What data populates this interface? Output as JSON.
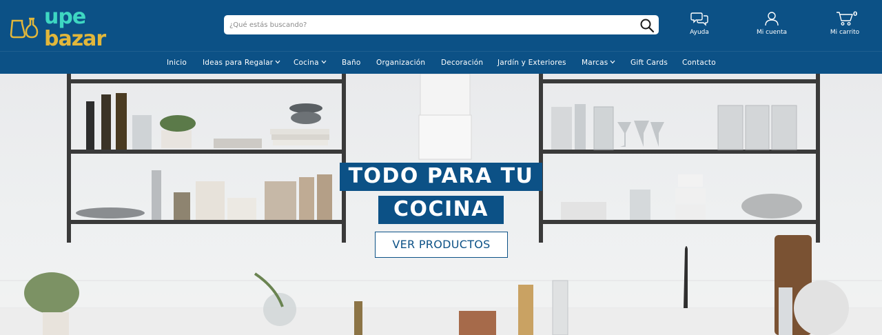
{
  "brand": {
    "logo_line1": "upe",
    "logo_line2": "bazar"
  },
  "search": {
    "placeholder": "¿Qué estás buscando?"
  },
  "header_icons": {
    "help_label": "Ayuda",
    "account_label": "Mi cuenta",
    "cart_label": "Mi carrito",
    "cart_count": "0"
  },
  "nav": {
    "items": [
      {
        "label": "Inicio",
        "has_dropdown": false
      },
      {
        "label": "Ideas para Regalar",
        "has_dropdown": true
      },
      {
        "label": "Cocina",
        "has_dropdown": true
      },
      {
        "label": "Baño",
        "has_dropdown": false
      },
      {
        "label": "Organización",
        "has_dropdown": false
      },
      {
        "label": "Decoración",
        "has_dropdown": false
      },
      {
        "label": "Jardín y Exteriores",
        "has_dropdown": false
      },
      {
        "label": "Marcas",
        "has_dropdown": true
      },
      {
        "label": "Gift Cards",
        "has_dropdown": false
      },
      {
        "label": "Contacto",
        "has_dropdown": false
      }
    ]
  },
  "hero": {
    "headline_line1": "TODO PARA TU",
    "headline_line2": "COCINA",
    "cta_label": "VER PRODUCTOS"
  },
  "colors": {
    "header_bg": "#0c5186",
    "logo_teal": "#3ed7c2",
    "logo_gold": "#e2b73b",
    "banner_bg": "#0c5186"
  }
}
